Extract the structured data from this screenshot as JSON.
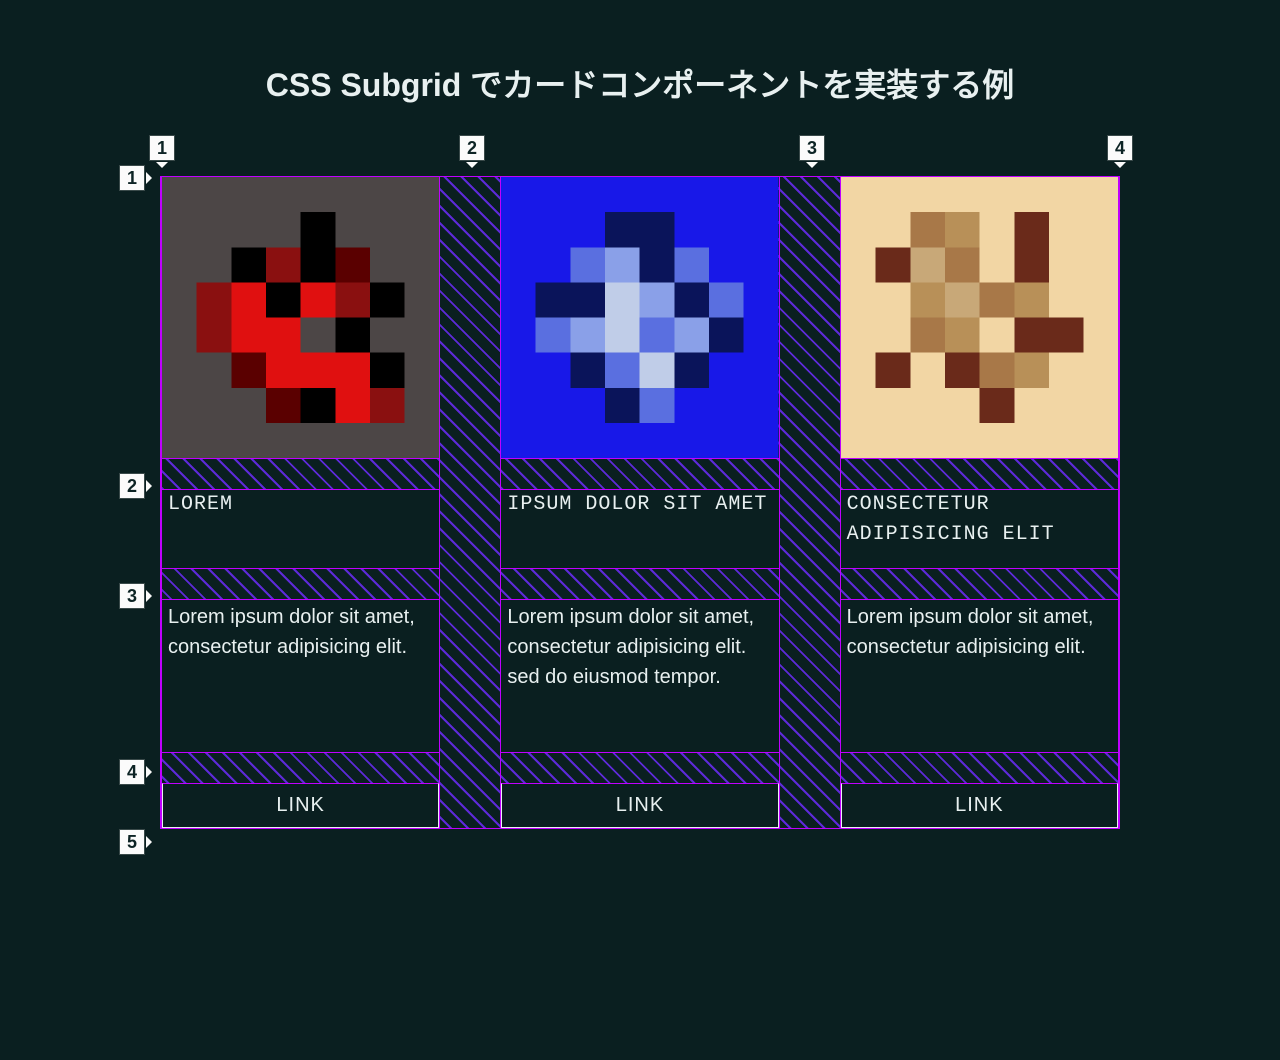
{
  "title": "CSS Subgrid でカードコンポーネントを実装する例",
  "colMarkers": [
    "1",
    "2",
    "3",
    "4"
  ],
  "rowMarkers": [
    "1",
    "2",
    "3",
    "4",
    "5"
  ],
  "linkLabel": "LINK",
  "cards": [
    {
      "title": "LOREM",
      "body": "Lorem ipsum dolor sit amet, consectetur adipisicing elit.",
      "link": "LINK"
    },
    {
      "title": "IPSUM DOLOR SIT AMET",
      "body": "Lorem ipsum dolor sit amet, consectetur adipisicing elit. sed do eiusmod tempor.",
      "link": "LINK"
    },
    {
      "title": "CONSECTETUR ADIPISICING ELIT",
      "body": "Lorem ipsum dolor sit amet, consectetur adipisicing elit.",
      "link": "LINK"
    }
  ]
}
